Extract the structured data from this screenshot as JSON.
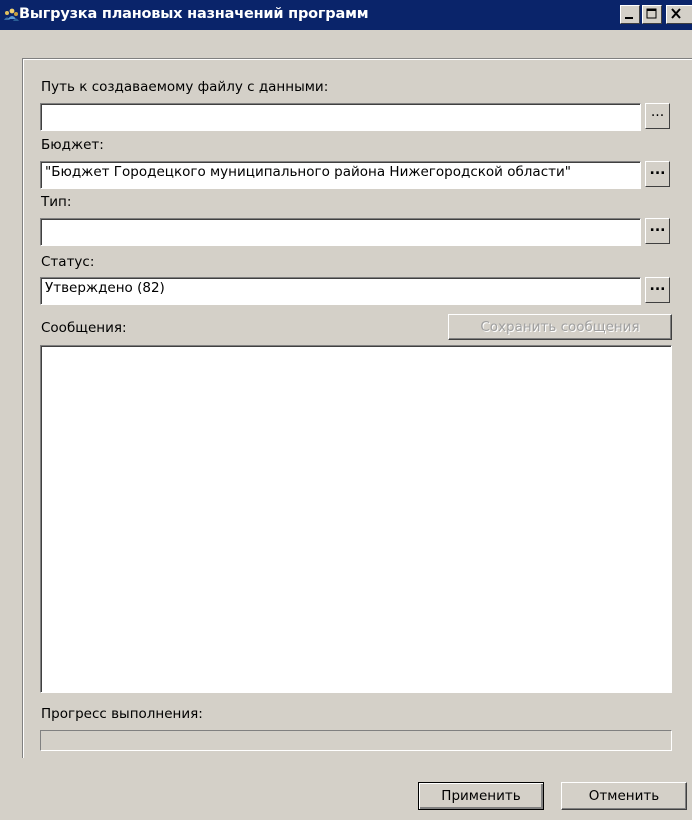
{
  "window": {
    "title": "Выгрузка плановых назначений программ"
  },
  "form": {
    "file_path": {
      "label": "Путь к создаваемому файлу с данными:",
      "value": ""
    },
    "budget": {
      "label": "Бюджет:",
      "value": "\"Бюджет Городецкого муниципального района Нижегородской области\""
    },
    "type": {
      "label": "Тип:",
      "value": ""
    },
    "status": {
      "label": "Статус:",
      "value": "Утверждено (82)"
    },
    "browse_label": "..."
  },
  "messages": {
    "label": "Сообщения:",
    "save_label": "Сохранить сообщения",
    "text": ""
  },
  "progress": {
    "label": "Прогресс выполнения:",
    "value": 0
  },
  "buttons": {
    "apply": "Применить",
    "cancel": "Отменить"
  },
  "icons": {
    "window_icon": "people-icon",
    "minimize": "minimize-icon",
    "maximize": "maximize-icon",
    "close": "close-icon"
  }
}
